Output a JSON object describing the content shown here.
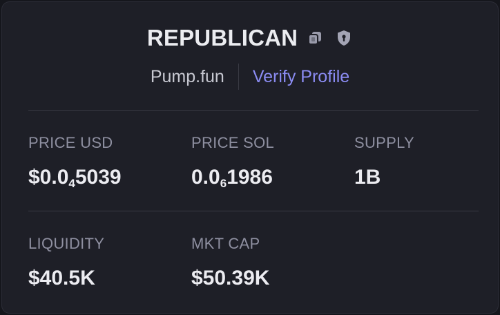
{
  "token": {
    "name": "REPUBLICAN",
    "copy_icon": "copy-icon",
    "shield_icon": "shield-icon"
  },
  "profile": {
    "platform": "Pump.fun",
    "verify_label": "Verify Profile"
  },
  "stats": {
    "price_usd": {
      "label": "PRICE USD",
      "prefix": "$0.0",
      "zeros": "4",
      "digits": "5039"
    },
    "price_sol": {
      "label": "PRICE SOL",
      "prefix": "0.0",
      "zeros": "6",
      "digits": "1986"
    },
    "supply": {
      "label": "SUPPLY",
      "value": "1B"
    },
    "liquidity": {
      "label": "LIQUIDITY",
      "value": "$40.5K"
    },
    "mkt_cap": {
      "label": "MKT CAP",
      "value": "$50.39K"
    }
  },
  "colors": {
    "background": "#1e1f27",
    "accent": "#8b8cf3",
    "label": "#8e8fa0",
    "value": "#ececf1"
  }
}
